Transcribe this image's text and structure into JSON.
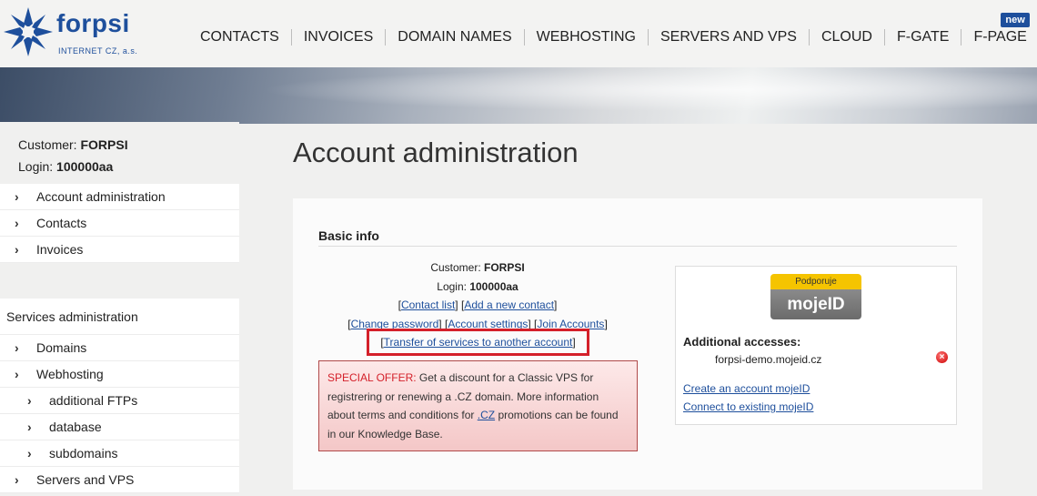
{
  "brand": {
    "name": "forpsi",
    "subtitle": "INTERNET CZ, a.s.",
    "color": "#1e4f9c"
  },
  "nav": {
    "items": [
      "CONTACTS",
      "INVOICES",
      "DOMAIN NAMES",
      "WEBHOSTING",
      "SERVERS AND VPS",
      "CLOUD",
      "F-GATE",
      "F-PAGE"
    ],
    "new_badge": "new"
  },
  "sidebar": {
    "customer_label": "Customer:",
    "customer_value": "FORPSI",
    "login_label": "Login:",
    "login_value": "100000aa",
    "menu": [
      "Account administration",
      "Contacts",
      "Invoices"
    ],
    "services_heading": "Services administration",
    "services": [
      {
        "label": "Domains",
        "sub": false
      },
      {
        "label": "Webhosting",
        "sub": false
      },
      {
        "label": "additional FTPs",
        "sub": true
      },
      {
        "label": "database",
        "sub": true
      },
      {
        "label": "subdomains",
        "sub": true
      },
      {
        "label": "Servers and VPS",
        "sub": false
      }
    ],
    "chevron": "›"
  },
  "main": {
    "title": "Account administration",
    "basic_info": "Basic info",
    "customer_label": "Customer:",
    "customer_value": "FORPSI",
    "login_label": "Login:",
    "login_value": "100000aa",
    "links": {
      "contact_list": "Contact list",
      "add_contact": "Add a new contact",
      "change_password": "Change password",
      "account_settings": "Account settings",
      "join_accounts": "Join Accounts",
      "transfer": "Transfer of services to another account"
    },
    "offer": {
      "highlight": "SPECIAL OFFER:",
      "text1": " Get a discount for a Classic VPS for registrering or renewing a .CZ domain. More information about terms and conditions for ",
      "link": ".CZ",
      "text2": " promotions can be found in our Knowledge Base."
    },
    "mojeid": {
      "badge_top": "Podporuje",
      "badge_bottom": "mojeID",
      "additional_accesses": "Additional accesses:",
      "account": "forpsi-demo.mojeid.cz",
      "remove_glyph": "×",
      "create_link": "Create an account mojeID",
      "connect_link": "Connect to existing mojeID"
    }
  }
}
